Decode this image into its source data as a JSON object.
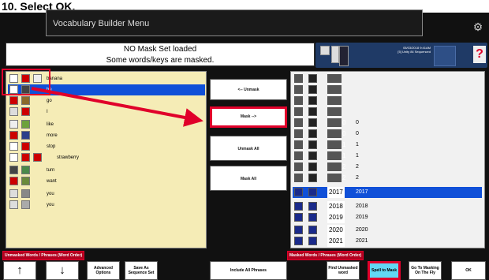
{
  "caption": "10. Select OK.",
  "titlebar": {
    "text": "Vocabulary Builder Menu"
  },
  "status": {
    "line1": "NO Mask Set loaded",
    "line2": "Some words/keys are masked."
  },
  "device": {
    "date": "05/03/2018 9:41AM",
    "setname": "[5] Unity 84 Sequenced"
  },
  "left_panel": {
    "label": "Unmasked Words / Phrases (Word Order)",
    "items": [
      {
        "label": "banana",
        "selected": false
      },
      {
        "label": "be",
        "selected": true
      },
      {
        "label": "go",
        "selected": false
      },
      {
        "label": "I",
        "selected": false
      },
      {
        "label": "like",
        "selected": false
      },
      {
        "label": "more",
        "selected": false
      },
      {
        "label": "stop",
        "selected": false
      },
      {
        "label": "strawberry",
        "selected": false
      },
      {
        "label": "turn",
        "selected": false
      },
      {
        "label": "want",
        "selected": false
      },
      {
        "label": "you",
        "selected": false
      },
      {
        "label": "you",
        "selected": false
      }
    ]
  },
  "center_buttons": {
    "unmask": "<-- Unmask",
    "mask": "Mask -->",
    "unmask_all": "Unmask All",
    "mask_all": "Mask All"
  },
  "right_panel": {
    "label": "Masked Words / Phrases (Word Order)",
    "items": [
      {
        "num": "",
        "num2": ""
      },
      {
        "num": "",
        "num2": ""
      },
      {
        "num": "",
        "num2": ""
      },
      {
        "num": "",
        "num2": ""
      },
      {
        "num": "0",
        "num2": "0"
      },
      {
        "num": "0",
        "num2": "0"
      },
      {
        "num": "1",
        "num2": "1"
      },
      {
        "num": "1",
        "num2": "1"
      },
      {
        "num": "2",
        "num2": "2"
      },
      {
        "num": "2",
        "num2": "2"
      },
      {
        "num": "2017",
        "num2": "2017",
        "selected": true
      },
      {
        "num": "2018",
        "num2": "2018"
      },
      {
        "num": "2019",
        "num2": "2019"
      },
      {
        "num": "2020",
        "num2": "2020"
      },
      {
        "num": "2021",
        "num2": "2021"
      }
    ]
  },
  "bottom": {
    "up": "↑",
    "down": "↓",
    "advanced": "Advanced Options",
    "save": "Save As Sequence Set",
    "include": "Include All Phrases",
    "find": "Find Unmasked word",
    "spell": "Spell to Mask",
    "goto": "Go To Masking On The Fly",
    "ok": "OK"
  },
  "colors": {
    "highlight": "#e0002a",
    "selection": "#1050d8",
    "spell": "#62d8f3"
  }
}
